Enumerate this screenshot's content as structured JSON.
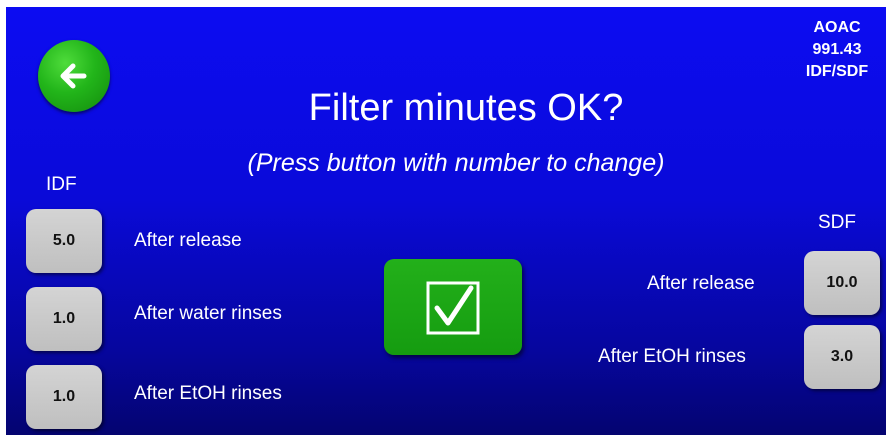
{
  "header": {
    "back_icon": "arrow-left-icon",
    "method_lines": [
      "AOAC",
      "991.43",
      "IDF/SDF"
    ],
    "title": "Filter minutes OK?",
    "subtitle": "(Press button with number to change)"
  },
  "idf": {
    "label": "IDF",
    "rows": [
      {
        "value": "5.0",
        "label": "After release"
      },
      {
        "value": "1.0",
        "label": "After water rinses"
      },
      {
        "value": "1.0",
        "label": "After EtOH rinses"
      }
    ]
  },
  "sdf": {
    "label": "SDF",
    "rows": [
      {
        "value": "10.0",
        "label": "After release"
      },
      {
        "value": "3.0",
        "label": "After EtOH rinses"
      }
    ]
  },
  "confirm": {
    "icon": "checkbox-check-icon"
  },
  "colors": {
    "background": "#0a0ad8",
    "button_green": "#1aa614",
    "button_gray": "#c8c8c8",
    "text": "#ffffff"
  }
}
